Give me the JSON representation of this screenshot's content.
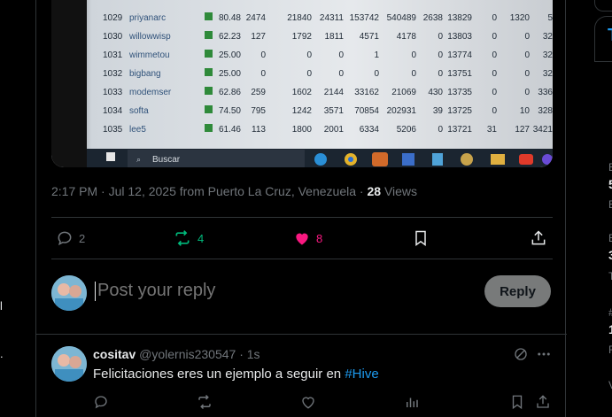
{
  "left_sidebar": {
    "glyphs": [
      "l",
      "."
    ]
  },
  "photo": {
    "rows": [
      {
        "id": "1029",
        "name": "priyanarc",
        "score": "80.48",
        "a": "2474",
        "b": "21840",
        "c": "24311",
        "d": "153742",
        "e": "540489",
        "f": "2638",
        "g": "13829",
        "h": "0",
        "i": "1320",
        "j": "5"
      },
      {
        "id": "1030",
        "name": "willowwisp",
        "score": "62.23",
        "a": "127",
        "b": "1792",
        "c": "1811",
        "d": "4571",
        "e": "4178",
        "f": "0",
        "g": "13803",
        "h": "0",
        "i": "0",
        "j": "32"
      },
      {
        "id": "1031",
        "name": "wimmetou",
        "score": "25.00",
        "a": "0",
        "b": "0",
        "c": "0",
        "d": "1",
        "e": "0",
        "f": "0",
        "g": "13774",
        "h": "0",
        "i": "0",
        "j": "32"
      },
      {
        "id": "1032",
        "name": "bigbang",
        "score": "25.00",
        "a": "0",
        "b": "0",
        "c": "0",
        "d": "0",
        "e": "0",
        "f": "0",
        "g": "13751",
        "h": "0",
        "i": "0",
        "j": "32"
      },
      {
        "id": "1033",
        "name": "modemser",
        "score": "62.86",
        "a": "259",
        "b": "1602",
        "c": "2144",
        "d": "33162",
        "e": "21069",
        "f": "430",
        "g": "13735",
        "h": "0",
        "i": "0",
        "j": "336"
      },
      {
        "id": "1034",
        "name": "softa",
        "score": "74.50",
        "a": "795",
        "b": "1242",
        "c": "3571",
        "d": "70854",
        "e": "202931",
        "f": "39",
        "g": "13725",
        "h": "0",
        "i": "10",
        "j": "328"
      },
      {
        "id": "1035",
        "name": "lee5",
        "score": "61.46",
        "a": "113",
        "b": "1800",
        "c": "2001",
        "d": "6334",
        "e": "5206",
        "f": "0",
        "g": "13721",
        "h": "31",
        "i": "127",
        "j": "3421"
      }
    ],
    "taskbar_search": "Buscar"
  },
  "post_meta": {
    "time": "2:17 PM",
    "date": "Jul 12, 2025",
    "location": "from Puerto La Cruz, Venezuela",
    "views_count": "28",
    "views_label": "Views",
    "separator": "·"
  },
  "actions": {
    "reply_count": "2",
    "repost_count": "4",
    "like_count": "8"
  },
  "reply_box": {
    "placeholder": "Post your reply",
    "button": "Reply"
  },
  "comment": {
    "name": "cositav",
    "handle": "@yolernis230547",
    "time": "· 1s",
    "text": "Felicitaciones eres un ejemplo a seguir en ",
    "hashtag": "#Hive"
  },
  "right_sidebar": {
    "items": [
      "T",
      "E",
      "5",
      "E",
      "E",
      "3",
      "T",
      "#",
      "1",
      "F",
      "V"
    ]
  },
  "colors": {
    "accent": "#1d9bf0",
    "like": "#f91880",
    "repost": "#00ba7c",
    "muted": "#71767b"
  }
}
